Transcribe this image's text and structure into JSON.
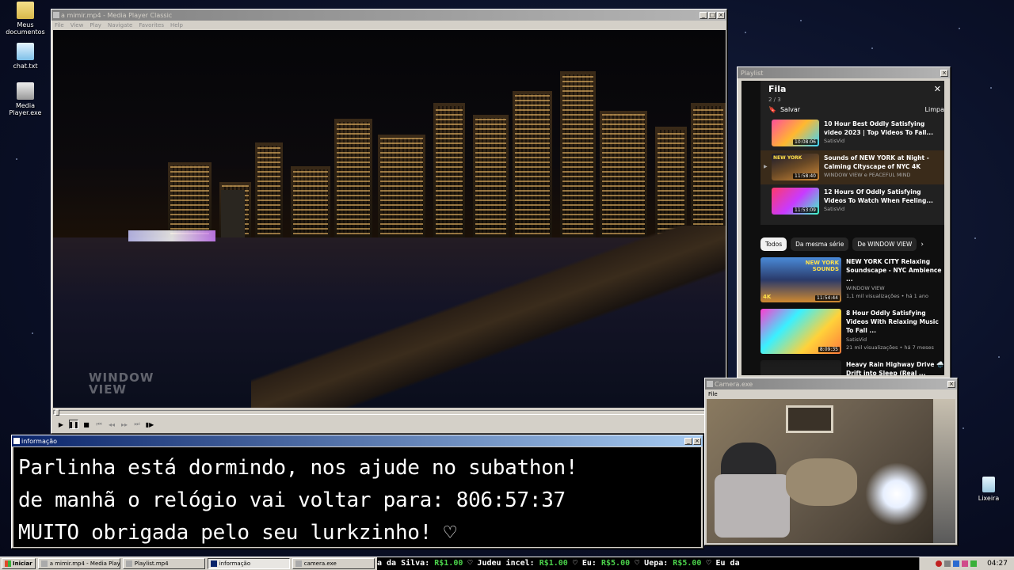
{
  "desktop": {
    "icons": [
      {
        "label": "Meus documentos",
        "icon": "folder-icon"
      },
      {
        "label": "chat.txt",
        "icon": "text-file-icon"
      },
      {
        "label": "Media Player.exe",
        "icon": "media-player-icon"
      },
      {
        "label": "Lixeira",
        "icon": "recycle-bin-icon"
      }
    ]
  },
  "player": {
    "title": "a mimir.mp4 - Media Player Classic",
    "menu": [
      "File",
      "View",
      "Play",
      "Navigate",
      "Favorites",
      "Help"
    ],
    "watermark_line1": "WINDOW",
    "watermark_line2": "VIEW",
    "progress": 0.002
  },
  "playlist": {
    "title": "Playlist",
    "queue_title": "Fila",
    "queue_position": "2 / 3",
    "save_label": "Salvar",
    "clear_label": "Limpa",
    "items": [
      {
        "title": "10 Hour Best Oddly Satisfying video 2023 | Top Videos To Fall...",
        "channel": "SatisVid",
        "duration": "10:08:06"
      },
      {
        "title": "Sounds of NEW YORK at Night - Calming Cityscape of NYC 4K",
        "channel": "WINDOW VIEW e PEACEFUL MIND",
        "duration": "11:58:40",
        "current": true,
        "thumb_text": "NEW YORK"
      },
      {
        "title": "12 Hours Of Oddly Satisfying Videos To Watch When Feeling...",
        "channel": "SatisVid",
        "duration": "11:53:09"
      }
    ],
    "chips": [
      "Todos",
      "Da mesma série",
      "De WINDOW VIEW"
    ],
    "recommended": [
      {
        "title": "NEW YORK CITY Relaxing Soundscape - NYC Ambience ...",
        "channel": "WINDOW VIEW",
        "stats": "1,1 mil visualizações • há 1 ano",
        "duration": "11:54:44",
        "badge": "4K",
        "thumb_text": "NEW YORK SOUNDS"
      },
      {
        "title": "8 Hour Oddly Satisfying Videos With Relaxing Music To Fall ...",
        "channel": "SatisVid",
        "stats": "21 mil visualizações • há 7 meses",
        "duration": "8:09:35"
      },
      {
        "title": "Heavy Rain Highway Drive 🌧️ Drift into Sleep (Real ...",
        "channel": "",
        "stats": "",
        "duration": ""
      }
    ]
  },
  "info": {
    "title": "informação",
    "line1": "Parlinha está dormindo, nos ajude no subathon!",
    "line2": "de manhã o relógio vai voltar para:  806:57:37",
    "line3": "MUITO obrigada pelo seu lurkzinho! ♡"
  },
  "camera": {
    "title": "Camera.exe",
    "menu_file": "File"
  },
  "taskbar": {
    "start_label": "Iniciar",
    "tasks": [
      {
        "label": "a mimir.mp4 - Media Playe...",
        "active": false
      },
      {
        "label": "Playlist.mp4",
        "active": false
      },
      {
        "label": "informação",
        "active": true
      },
      {
        "label": "camera.exe",
        "active": false
      }
    ],
    "ticker": [
      {
        "text": "a da Silva: ",
        "amount": "R$1.00"
      },
      {
        "text": " ♡ Judeu incel: ",
        "amount": "R$1.00"
      },
      {
        "text": " ♡ Eu: ",
        "amount": "R$5.00"
      },
      {
        "text": " ♡ Uepa: ",
        "amount": "R$5.00"
      },
      {
        "text": " ♡ Eu da",
        "amount": ""
      }
    ],
    "clock": "04:27"
  }
}
